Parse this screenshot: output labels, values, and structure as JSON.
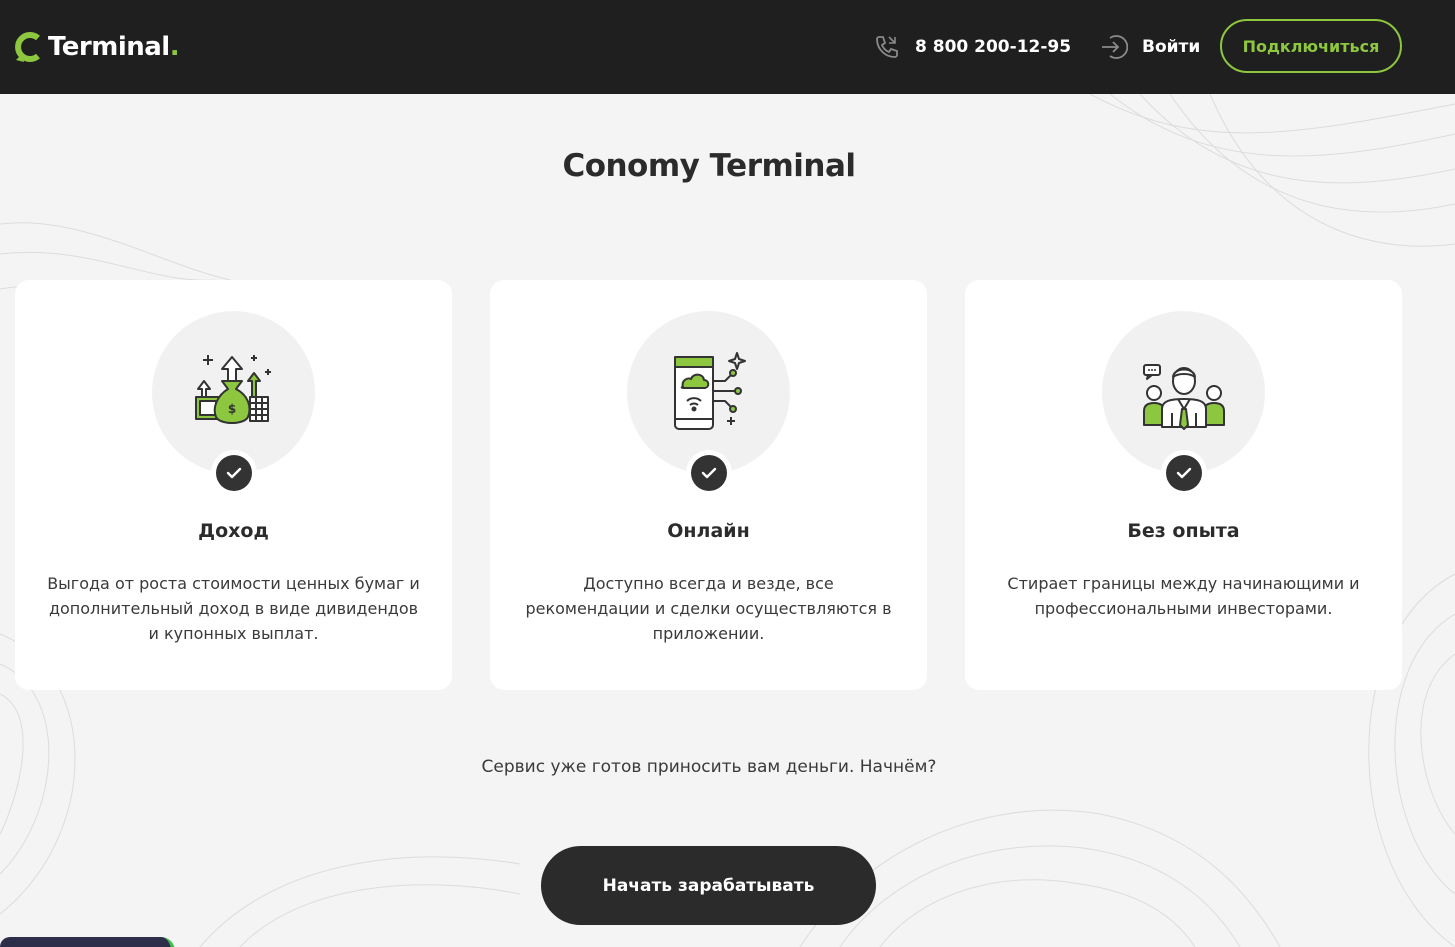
{
  "header": {
    "logo_text": "Terminal",
    "logo_dot": ".",
    "phone": "8 800 200-12-95",
    "login_label": "Войти",
    "connect_label": "Подключиться"
  },
  "main": {
    "title": "Conomy Terminal",
    "cards": [
      {
        "icon": "money-bag-growth-icon",
        "title": "Доход",
        "description": "Выгода от роста стоимости ценных бумаг и дополнительный доход в виде дивидендов и купонных выплат."
      },
      {
        "icon": "mobile-cloud-icon",
        "title": "Онлайн",
        "description": "Доступно всегда и везде, все рекомендации и сделки осуществляются в приложении."
      },
      {
        "icon": "team-people-icon",
        "title": "Без опыта",
        "description": "Стирает границы между начинающими и профессиональными инвесторами."
      }
    ],
    "cta_text": "Сервис уже готов приносить вам деньги. Начнём?",
    "cta_button": "Начать зарабатывать"
  },
  "colors": {
    "accent": "#8dc63f",
    "header_bg": "#1f1f1f",
    "page_bg": "#f4f4f4",
    "button_dark": "#2b2b2b"
  }
}
